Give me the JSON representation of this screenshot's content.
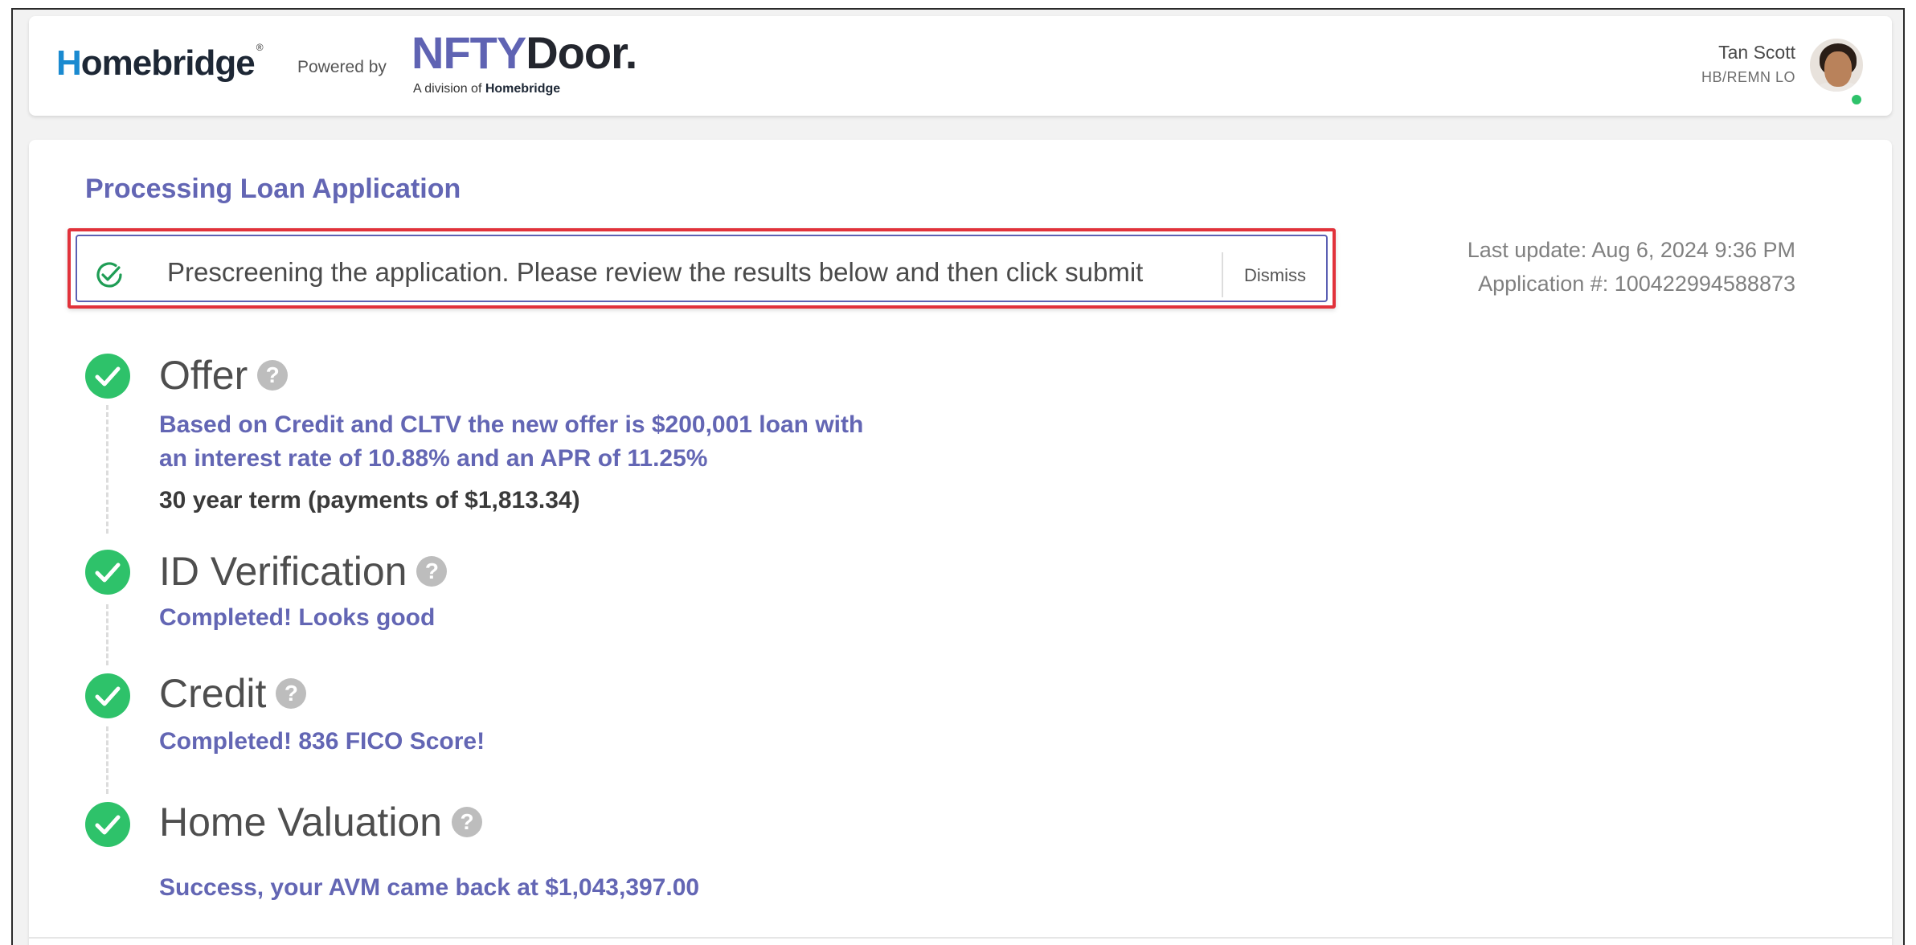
{
  "header": {
    "logo_prefix": "H",
    "logo_rest": "omebridge",
    "logo_reg": "®",
    "powered_by": "Powered by",
    "nfty_part1": "NFTY",
    "nfty_part2": "Door.",
    "division_text": "A division of",
    "division_brand": "Homebridge",
    "user_name": "Tan Scott",
    "user_role": "HB/REMN LO",
    "brand_color": "#5f63b3"
  },
  "main": {
    "title": "Processing Loan Application",
    "alert": {
      "message": "Prescreening the application. Please review the results below and then click submit",
      "dismiss_label": "Dismiss",
      "icon": "check-circle-icon"
    },
    "last_update": "Last update: Aug 6, 2024 9:36 PM",
    "application_number": "Application #: 100422994588873",
    "steps": [
      {
        "title": "Offer",
        "desc_line1": "Based on Credit and CLTV the new offer is $200,001 loan with",
        "desc_line2": "an interest rate of 10.88% and an APR of 11.25%",
        "sub": "30 year term (payments of $1,813.34)",
        "status": "complete"
      },
      {
        "title": "ID Verification",
        "desc_line1": "Completed! Looks good",
        "status": "complete"
      },
      {
        "title": "Credit",
        "desc_line1": "Completed! 836 FICO Score!",
        "status": "complete"
      },
      {
        "title": "Home Valuation",
        "desc_line1": "Success, your AVM came back at $1,043,397.00",
        "status": "complete"
      }
    ],
    "help_glyph": "?",
    "success_color": "#2ec26a",
    "accent_color": "#6366b4"
  }
}
